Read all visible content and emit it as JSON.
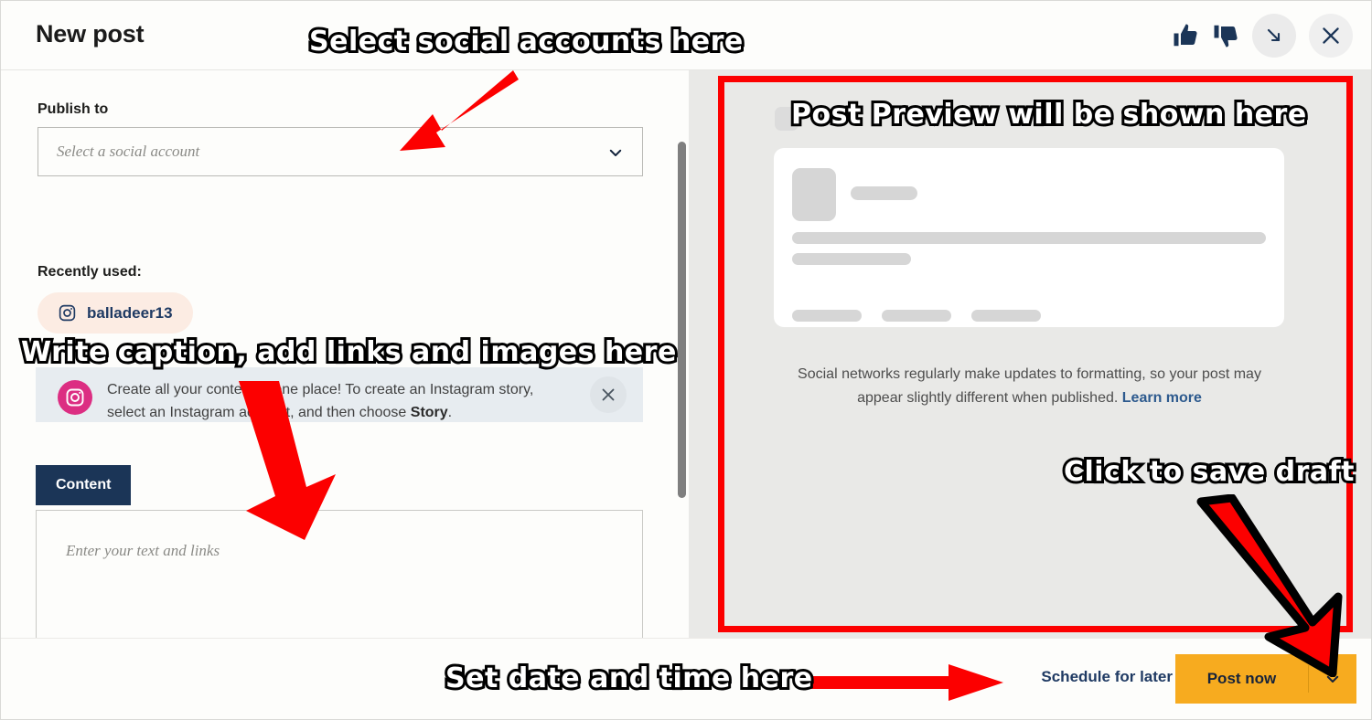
{
  "header": {
    "title": "New post",
    "thumbs_up_icon": "thumbs-up-icon",
    "thumbs_down_icon": "thumbs-down-icon",
    "minimize_icon": "arrow-down-right-icon",
    "close_icon": "close-icon"
  },
  "left": {
    "publish_to_label": "Publish to",
    "account_select_placeholder": "Select a social account",
    "account_select_value": "",
    "chevron_icon": "chevron-down-icon",
    "recently_used_label": "Recently used:",
    "recent_accounts": [
      {
        "name": "balladeer13",
        "icon": "instagram-icon"
      }
    ],
    "banner": {
      "icon": "instagram-icon",
      "text_part1": "Create all your content in one place! To create an Instagram story, select an Instagram account, and then choose ",
      "text_bold": "Story",
      "text_part2": ".",
      "close_icon": "close-icon"
    },
    "tabs": [
      {
        "label": "Content",
        "active": true
      }
    ],
    "editor_placeholder": "Enter your text and links",
    "editor_value": ""
  },
  "right": {
    "preview_card": {
      "skeleton": true,
      "placeholder_blocks": [
        "avatar",
        "name",
        "line-long",
        "line-short",
        "button",
        "button",
        "button"
      ]
    },
    "disclaimer_text": "Social networks regularly make updates to formatting, so your post may appear slightly different when published. ",
    "disclaimer_link": "Learn more"
  },
  "footer": {
    "schedule_label": "Schedule for later",
    "post_now_label": "Post now",
    "post_now_caret_icon": "chevron-down-icon"
  },
  "annotations": [
    {
      "id": "a",
      "text": "Select social accounts here"
    },
    {
      "id": "b",
      "text": "Post Preview will be shown here"
    },
    {
      "id": "c",
      "text": "Write caption, add links and images here"
    },
    {
      "id": "d",
      "text": "Click to save draft"
    },
    {
      "id": "e",
      "text": "Set date and time here"
    }
  ],
  "colors": {
    "accent_orange": "#f7ab1f",
    "navy": "#1b3557",
    "annotation_red": "#fc0000",
    "instagram_pink": "#dc2e82",
    "chip_bg": "#fcece3",
    "banner_bg": "#e7ecf0",
    "preview_bg": "#e9e9e7"
  }
}
